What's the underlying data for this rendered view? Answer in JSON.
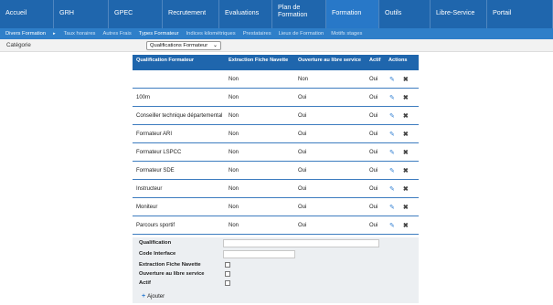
{
  "nav": {
    "items": [
      {
        "label": "Accueil",
        "width": 59
      },
      {
        "label": "GRH",
        "width": 60
      },
      {
        "label": "GPEC",
        "width": 59
      },
      {
        "label": "Recrutement",
        "width": 62
      },
      {
        "label": "Evaluations",
        "width": 58
      },
      {
        "label": "Plan de Formation",
        "width": 59
      },
      {
        "label": "Formation",
        "width": 58
      },
      {
        "label": "Outils",
        "width": 56
      },
      {
        "label": "Libre-Service",
        "width": 62
      },
      {
        "label": "Portail",
        "width": 72
      }
    ],
    "active": "Formation"
  },
  "subnav": {
    "items": [
      "Divers Formation",
      "Taux horaires",
      "Autres Frais",
      "Types Formateur",
      "Indices kilométriques",
      "Prestataires",
      "Lieux de Formation",
      "Motifs stages"
    ]
  },
  "category": {
    "label": "Catégorie",
    "selected": "Qualifications Formateur"
  },
  "table": {
    "headers": {
      "qualification": "Qualification Formateur",
      "extraction": "Extraction Fiche Navette",
      "ouverture": "Ouverture au libre service",
      "actif": "Actif",
      "actions": "Actions"
    },
    "rows": [
      {
        "qualification": "",
        "extraction": "Non",
        "ouverture": "Non",
        "actif": "Oui"
      },
      {
        "qualification": "100m",
        "extraction": "Non",
        "ouverture": "Oui",
        "actif": "Oui"
      },
      {
        "qualification": "Conseiller technique départemental",
        "extraction": "Non",
        "ouverture": "Oui",
        "actif": "Oui"
      },
      {
        "qualification": "Formateur ARI",
        "extraction": "Non",
        "ouverture": "Oui",
        "actif": "Oui"
      },
      {
        "qualification": "Formateur LSPCC",
        "extraction": "Non",
        "ouverture": "Oui",
        "actif": "Oui"
      },
      {
        "qualification": "Formateur SDE",
        "extraction": "Non",
        "ouverture": "Oui",
        "actif": "Oui"
      },
      {
        "qualification": "Instructeur",
        "extraction": "Non",
        "ouverture": "Oui",
        "actif": "Oui"
      },
      {
        "qualification": "Moniteur",
        "extraction": "Non",
        "ouverture": "Oui",
        "actif": "Oui"
      },
      {
        "qualification": "Parcours sportif",
        "extraction": "Non",
        "ouverture": "Oui",
        "actif": "Oui"
      }
    ]
  },
  "form": {
    "qualification_label": "Qualification",
    "code_label": "Code Interface",
    "extraction_label": "Extraction Fiche Navette",
    "ouverture_label": "Ouverture au libre service",
    "actif_label": "Actif",
    "add_label": "Ajouter"
  },
  "colors": {
    "nav_bg": "#1f66ad",
    "subnav_bg": "#2f7fc9",
    "accent": "#2d7dd2"
  }
}
